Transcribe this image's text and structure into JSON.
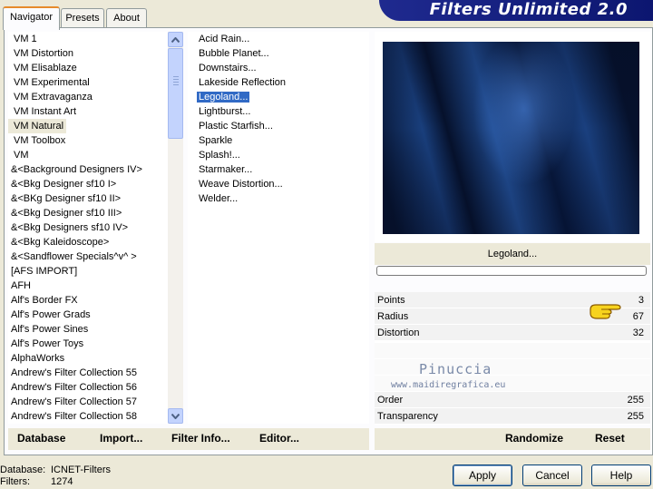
{
  "tabs": [
    {
      "label": "Navigator",
      "active": true
    },
    {
      "label": "Presets",
      "active": false
    },
    {
      "label": "About",
      "active": false
    }
  ],
  "brand": "Filters Unlimited 2.0",
  "categories": [
    "VM 1",
    "VM Distortion",
    "VM Elisablaze",
    "VM Experimental",
    "VM Extravaganza",
    "VM Instant Art",
    "VM Natural",
    "VM Toolbox",
    "VM",
    "&<Background Designers IV>",
    "&<Bkg Designer sf10 I>",
    "&<BKg Designer sf10 II>",
    "&<Bkg Designer sf10 III>",
    "&<Bkg Designers sf10 IV>",
    "&<Bkg Kaleidoscope>",
    "&<Sandflower Specials^v^ >",
    "[AFS IMPORT]",
    "AFH",
    "Alf's Border FX",
    "Alf's Power Grads",
    "Alf's Power Sines",
    "Alf's Power Toys",
    "AlphaWorks",
    "Andrew's Filter Collection 55",
    "Andrew's Filter Collection 56",
    "Andrew's Filter Collection 57",
    "Andrew's Filter Collection 58"
  ],
  "selected_category": "VM Natural",
  "filters": [
    "Acid Rain...",
    "Bubble Planet...",
    "Downstairs...",
    "Lakeside Reflection",
    "Legoland...",
    "Lightburst...",
    "Plastic Starfish...",
    "Sparkle",
    "Splash!...",
    "Starmaker...",
    "Weave Distortion...",
    "Welder..."
  ],
  "selected_filter": "Legoland...",
  "current_filter_name": "Legoland...",
  "progress": 0,
  "params": [
    {
      "label": "Points",
      "value": "3"
    },
    {
      "label": "Radius",
      "value": "67"
    },
    {
      "label": "Distortion",
      "value": "32"
    },
    {
      "label": "",
      "value": ""
    },
    {
      "label": "",
      "value": ""
    },
    {
      "label": "",
      "value": ""
    },
    {
      "label": "Order",
      "value": "255"
    },
    {
      "label": "Transparency",
      "value": "255"
    }
  ],
  "watermark": {
    "name": "Pinuccia",
    "url": "www.maidiregrafica.eu"
  },
  "links": {
    "database": "Database",
    "import": "Import...",
    "filter_info": "Filter Info...",
    "editor": "Editor...",
    "randomize": "Randomize",
    "reset": "Reset"
  },
  "status": {
    "database_label": "Database:",
    "database_value": "ICNET-Filters",
    "filters_label": "Filters:",
    "filters_value": "1274"
  },
  "buttons": {
    "apply": "Apply",
    "cancel": "Cancel",
    "help": "Help"
  },
  "colors": {
    "selection": "#316ac5",
    "brand_bar": "#1f2a8f",
    "panel": "#ece9d8"
  }
}
